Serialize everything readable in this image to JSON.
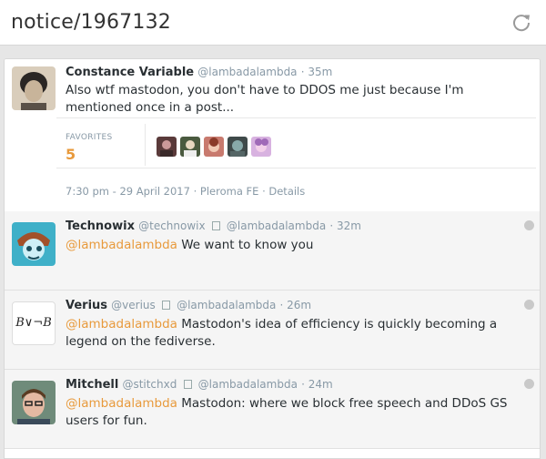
{
  "header": {
    "title": "notice/1967132",
    "refresh_icon": "refresh-icon"
  },
  "main": {
    "author_name": "Constance Variable",
    "author_handle": "@lambadalambda",
    "time_ago": "35m",
    "text": "Also wtf mastodon, you don't have to DDOS me just because I'm mentioned once in a post...",
    "favorites_label": "FAVORITES",
    "favorites_count": "5",
    "meta": "7:30 pm - 29 April 2017 · Pleroma FE · Details"
  },
  "replies": [
    {
      "name": "Technowix",
      "handle": "@technowix",
      "reply_to": "@lambadalambda",
      "time": "32m",
      "mention": "@lambadalambda",
      "text": " We want to know you"
    },
    {
      "name": "Verius",
      "handle": "@verius",
      "reply_to": "@lambadalambda",
      "time": "26m",
      "mention": "@lambadalambda",
      "text": " Mastodon's idea of efficiency is quickly becoming a legend on the fediverse.",
      "avatar_text": "B∨¬B"
    },
    {
      "name": "Mitchell",
      "handle": "@stitchxd",
      "reply_to": "@lambadalambda",
      "time": "24m",
      "mention": "@lambadalambda",
      "text": " Mastodon: where we block free speech and DDoS GS users for fun."
    }
  ],
  "colors": {
    "accent": "#e89a3c",
    "muted": "#8899a6"
  }
}
